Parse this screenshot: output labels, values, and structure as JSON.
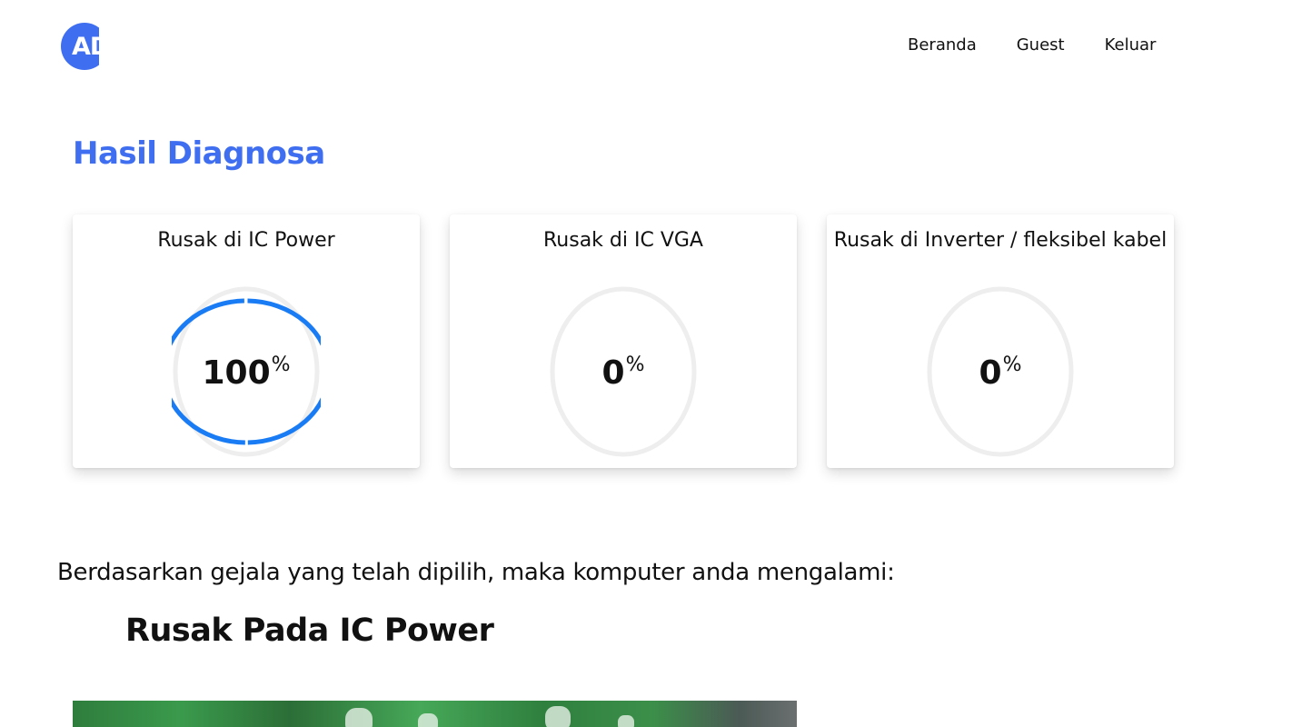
{
  "nav": {
    "logo_text": "AD",
    "links": [
      "Beranda",
      "Guest",
      "Keluar"
    ]
  },
  "page_title": "Hasil Diagnosa",
  "cards": [
    {
      "title": "Rusak di IC Power",
      "value": "100",
      "unit": "%",
      "fraction": 1.0
    },
    {
      "title": "Rusak di IC VGA",
      "value": "0",
      "unit": "%",
      "fraction": 0.0
    },
    {
      "title": "Rusak di Inverter / fleksibel kabel",
      "value": "0",
      "unit": "%",
      "fraction": 0.0
    }
  ],
  "description": "Berdasarkan gejala yang telah dipilih, maka komputer anda mengalami:",
  "result": "Rusak Pada IC Power",
  "colors": {
    "accent": "#3f6ff0",
    "gauge_fill": "#1a7cf5",
    "gauge_track": "#eeeeee"
  },
  "icons": {
    "logo": "logo-badge"
  }
}
